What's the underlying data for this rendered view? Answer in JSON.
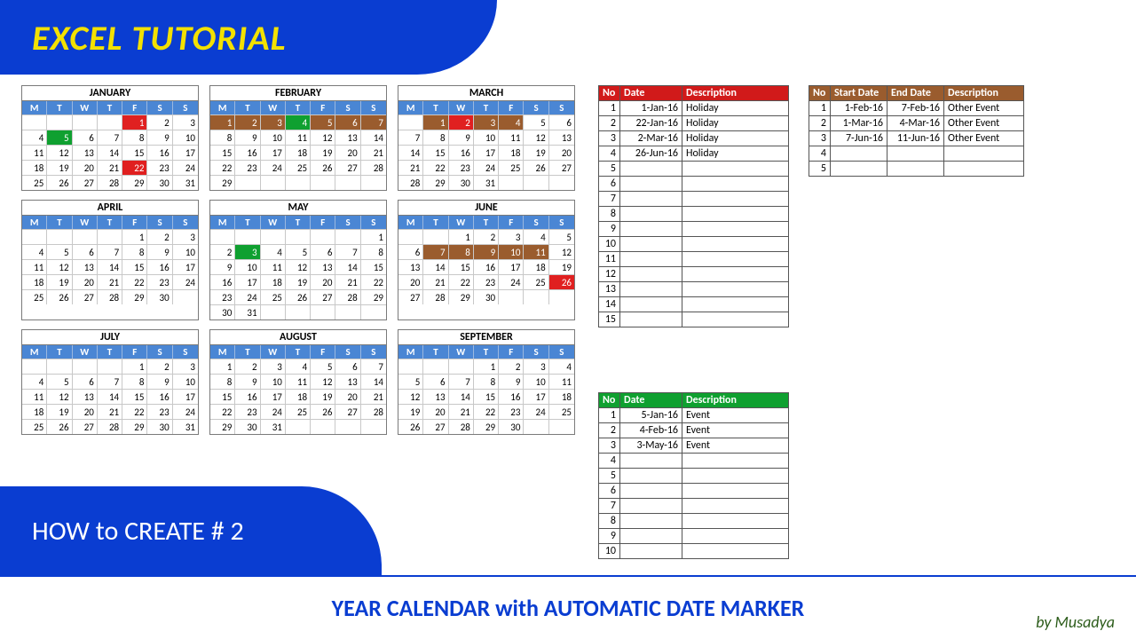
{
  "banner": {
    "title": "EXCEL TUTORIAL"
  },
  "pill": {
    "text": "HOW to CREATE # 2"
  },
  "footer": {
    "title": "YEAR CALENDAR with AUTOMATIC DATE MARKER",
    "by": "by Musadya"
  },
  "dow": [
    "M",
    "T",
    "W",
    "T",
    "F",
    "S",
    "S"
  ],
  "months": [
    {
      "name": "JANUARY",
      "start": 4,
      "days": 31,
      "marks": {
        "1": "red",
        "5": "green",
        "22": "red"
      }
    },
    {
      "name": "FEBRUARY",
      "start": 0,
      "days": 29,
      "marks": {
        "1": "brown",
        "2": "brown",
        "3": "brown",
        "4": "green",
        "5": "brown",
        "6": "brown",
        "7": "brown"
      }
    },
    {
      "name": "MARCH",
      "start": 1,
      "days": 31,
      "marks": {
        "1": "brown",
        "2": "red",
        "3": "brown",
        "4": "brown"
      }
    },
    {
      "name": "APRIL",
      "start": 4,
      "days": 30,
      "marks": {}
    },
    {
      "name": "MAY",
      "start": 6,
      "days": 31,
      "marks": {
        "3": "green"
      }
    },
    {
      "name": "JUNE",
      "start": 2,
      "days": 30,
      "marks": {
        "7": "brown",
        "8": "brown",
        "9": "brown",
        "10": "brown",
        "11": "brown",
        "26": "red"
      }
    },
    {
      "name": "JULY",
      "start": 4,
      "days": 31,
      "marks": {}
    },
    {
      "name": "AUGUST",
      "start": 0,
      "days": 31,
      "marks": {}
    },
    {
      "name": "SEPTEMBER",
      "start": 3,
      "days": 30,
      "marks": {}
    }
  ],
  "holidayTable": {
    "headers": [
      "No",
      "Date",
      "Description"
    ],
    "rowsCount": 15,
    "rows": [
      {
        "no": 1,
        "date": "1-Jan-16",
        "desc": "Holiday"
      },
      {
        "no": 2,
        "date": "22-Jan-16",
        "desc": "Holiday"
      },
      {
        "no": 3,
        "date": "2-Mar-16",
        "desc": "Holiday"
      },
      {
        "no": 4,
        "date": "26-Jun-16",
        "desc": "Holiday"
      }
    ]
  },
  "rangeTable": {
    "headers": [
      "No",
      "Start Date",
      "End Date",
      "Description"
    ],
    "rowsCount": 5,
    "rows": [
      {
        "no": 1,
        "sd": "1-Feb-16",
        "ed": "7-Feb-16",
        "desc": "Other Event"
      },
      {
        "no": 2,
        "sd": "1-Mar-16",
        "ed": "4-Mar-16",
        "desc": "Other Event"
      },
      {
        "no": 3,
        "sd": "7-Jun-16",
        "ed": "11-Jun-16",
        "desc": "Other Event"
      }
    ]
  },
  "eventTable": {
    "headers": [
      "No",
      "Date",
      "Description"
    ],
    "rowsCount": 10,
    "rows": [
      {
        "no": 1,
        "date": "5-Jan-16",
        "desc": "Event"
      },
      {
        "no": 2,
        "date": "4-Feb-16",
        "desc": "Event"
      },
      {
        "no": 3,
        "date": "3-May-16",
        "desc": "Event"
      }
    ]
  }
}
